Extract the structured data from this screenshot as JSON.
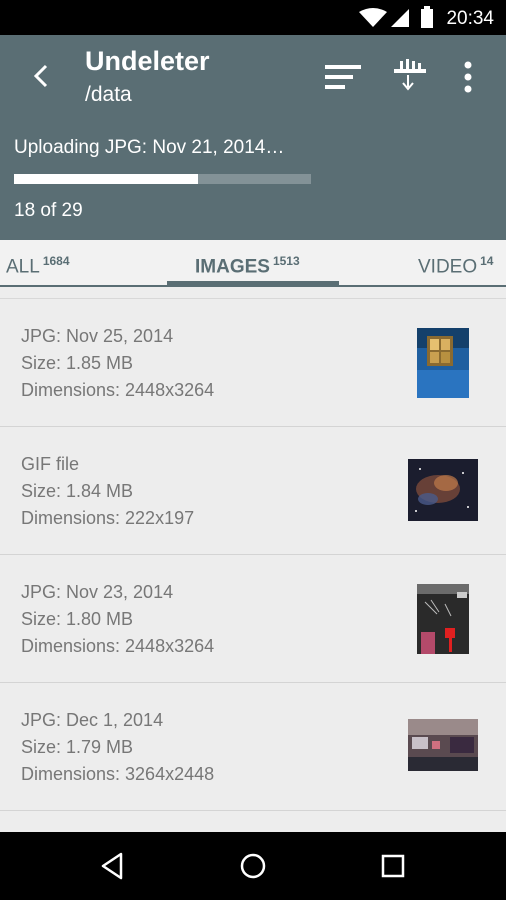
{
  "status": {
    "time": "20:34"
  },
  "header": {
    "title": "Undeleter",
    "subtitle": "/data"
  },
  "upload": {
    "text": "Uploading JPG: Nov 21, 2014…",
    "count": "18 of 29",
    "progress": 0.62
  },
  "tabs": [
    {
      "label": "ALL",
      "count": "1684"
    },
    {
      "label": "IMAGES",
      "count": "1513"
    },
    {
      "label": "VIDEO",
      "count": "14"
    }
  ],
  "items": [
    {
      "title": "JPG: Nov 25, 2014",
      "size": "Size: 1.85 MB",
      "dims": "Dimensions: 2448x3264"
    },
    {
      "title": "GIF file",
      "size": "Size: 1.84 MB",
      "dims": "Dimensions: 222x197"
    },
    {
      "title": "JPG: Nov 23, 2014",
      "size": "Size: 1.80 MB",
      "dims": "Dimensions: 2448x3264"
    },
    {
      "title": "JPG: Dec 1, 2014",
      "size": "Size: 1.79 MB",
      "dims": "Dimensions: 3264x2448"
    }
  ]
}
